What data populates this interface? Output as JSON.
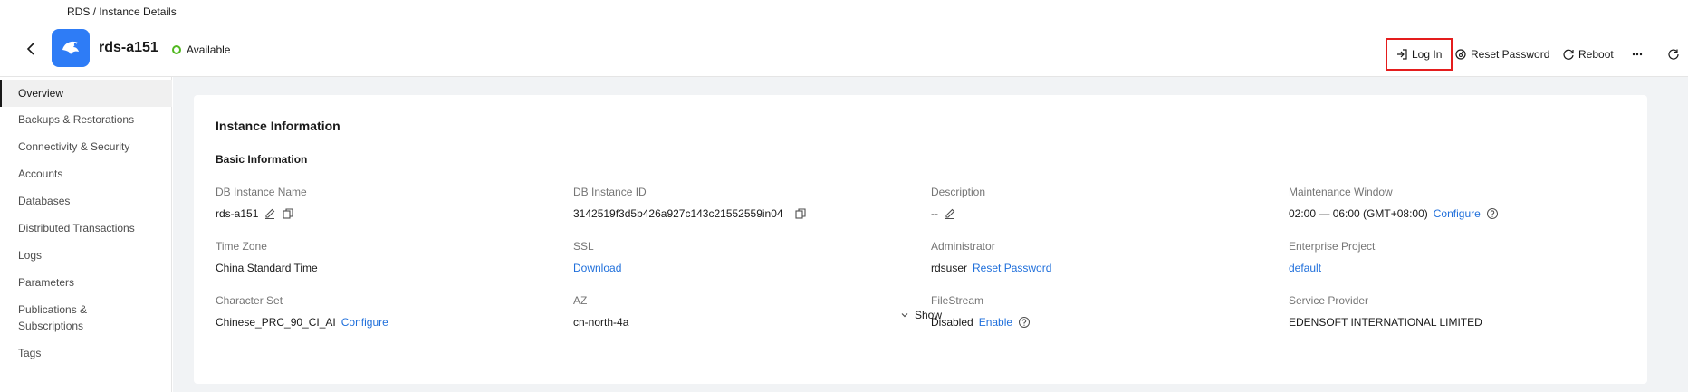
{
  "breadcrumb": "RDS / Instance Details",
  "header": {
    "instance_name": "rds-a151",
    "status": "Available",
    "actions": {
      "login": "Log In",
      "reset_password": "Reset Password",
      "reboot": "Reboot"
    }
  },
  "sidebar": {
    "items": [
      {
        "label": "Overview"
      },
      {
        "label": "Backups & Restorations"
      },
      {
        "label": "Connectivity & Security"
      },
      {
        "label": "Accounts"
      },
      {
        "label": "Databases"
      },
      {
        "label": "Distributed Transactions"
      },
      {
        "label": "Logs"
      },
      {
        "label": "Parameters"
      },
      {
        "label": "Publications & Subscriptions"
      },
      {
        "label": "Tags"
      }
    ],
    "active": "Overview"
  },
  "main": {
    "card_title": "Instance Information",
    "section_title": "Basic Information",
    "fields": {
      "db_instance_name": {
        "label": "DB Instance Name",
        "value": "rds-a151"
      },
      "db_instance_id": {
        "label": "DB Instance ID",
        "value": "3142519f3d5b426a927c143c21552559in04"
      },
      "description": {
        "label": "Description",
        "value": "--"
      },
      "maintenance_window": {
        "label": "Maintenance Window",
        "value": "02:00 — 06:00 (GMT+08:00)",
        "link": "Configure"
      },
      "time_zone": {
        "label": "Time Zone",
        "value": "China Standard Time"
      },
      "ssl": {
        "label": "SSL",
        "link": "Download"
      },
      "administrator": {
        "label": "Administrator",
        "value": "rdsuser",
        "link": "Reset Password"
      },
      "enterprise_project": {
        "label": "Enterprise Project",
        "link": "default"
      },
      "character_set": {
        "label": "Character Set",
        "value": "Chinese_PRC_90_CI_AI",
        "link": "Configure"
      },
      "az": {
        "label": "AZ",
        "value": "cn-north-4a"
      },
      "filestream": {
        "label": "FileStream",
        "value": "Disabled",
        "link": "Enable"
      },
      "service_provider": {
        "label": "Service Provider",
        "value": "EDENSOFT INTERNATIONAL LIMITED"
      }
    },
    "show_toggle": "Show"
  },
  "colors": {
    "accent_link": "#1f6fdb",
    "status_available": "#51b820",
    "highlight_box": "#e41d1d",
    "logo_bg": "#2e7cf6"
  }
}
